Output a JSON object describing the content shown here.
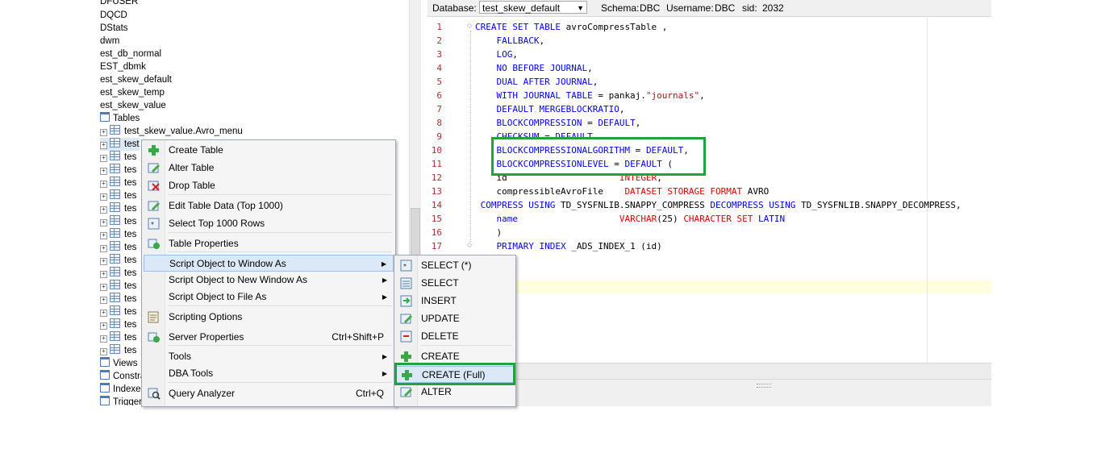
{
  "tree": {
    "items": [
      "DFUSER",
      "DQCD",
      "DStats",
      "dwm",
      "est_db_normal",
      "EST_dbmk",
      "est_skew_default",
      "est_skew_temp",
      "est_skew_value"
    ],
    "tables_folder": "Tables",
    "table_expanded": "test_skew_value.Avro_menu",
    "table_partial": "test",
    "table_rows": [
      "tes",
      "tes",
      "tes",
      "tes",
      "tes",
      "tes",
      "tes",
      "tes",
      "tes",
      "tes",
      "tes",
      "tes",
      "tes",
      "tes",
      "tes",
      "tes"
    ],
    "folders": [
      "Views",
      "Constra",
      "Indexes",
      "Triggers"
    ]
  },
  "toolbar": {
    "database_label": "Database:",
    "database_value": "test_skew_default",
    "schema_label": "Schema:",
    "schema_value": "DBC",
    "username_label": "Username:",
    "username_value": "DBC",
    "sid_label": "sid:",
    "sid_value": "2032"
  },
  "editor": {
    "line_numbers": [
      "1",
      "2",
      "3",
      "4",
      "5",
      "6",
      "7",
      "8",
      "9",
      "10",
      "11",
      "12",
      "13",
      "14",
      "15",
      "16",
      "17"
    ],
    "lines": [
      [
        {
          "t": "CREATE SET TABLE",
          "c": "kw"
        },
        {
          "t": " avroCompressTable ,",
          "c": ""
        }
      ],
      [
        {
          "t": "    FALLBACK",
          "c": "kw"
        },
        {
          "t": ",",
          "c": ""
        }
      ],
      [
        {
          "t": "    LOG",
          "c": "kw"
        },
        {
          "t": ",",
          "c": ""
        }
      ],
      [
        {
          "t": "    NO BEFORE JOURNAL",
          "c": "kw"
        },
        {
          "t": ",",
          "c": ""
        }
      ],
      [
        {
          "t": "    DUAL AFTER JOURNAL",
          "c": "kw"
        },
        {
          "t": ",",
          "c": ""
        }
      ],
      [
        {
          "t": "    WITH JOURNAL TABLE",
          "c": "kw"
        },
        {
          "t": " = pankaj.",
          "c": ""
        },
        {
          "t": "\"journals\"",
          "c": "st"
        },
        {
          "t": ",",
          "c": ""
        }
      ],
      [
        {
          "t": "    DEFAULT MERGEBLOCKRATIO",
          "c": "kw"
        },
        {
          "t": ",",
          "c": ""
        }
      ],
      [
        {
          "t": "    BLOCKCOMPRESSION",
          "c": "kw"
        },
        {
          "t": " = ",
          "c": ""
        },
        {
          "t": "DEFAULT",
          "c": "kw"
        },
        {
          "t": ",",
          "c": ""
        }
      ],
      [
        {
          "t": "    CHECKSUM",
          "c": "kw"
        },
        {
          "t": " = ",
          "c": ""
        },
        {
          "t": "DEFAULT",
          "c": "kw"
        }
      ],
      [
        {
          "t": "    BLOCKCOMPRESSIONALGORITHM",
          "c": "kw"
        },
        {
          "t": " = ",
          "c": ""
        },
        {
          "t": "DEFAULT",
          "c": "kw"
        },
        {
          "t": ",",
          "c": ""
        }
      ],
      [
        {
          "t": "    BLOCKCOMPRESSIONLEVEL",
          "c": "kw"
        },
        {
          "t": " = ",
          "c": ""
        },
        {
          "t": "DEFAULT",
          "c": "kw"
        },
        {
          "t": " (",
          "c": ""
        }
      ],
      [
        {
          "t": "    id",
          "c": ""
        },
        {
          "t": "                     INTEGER",
          "c": "ty"
        },
        {
          "t": ",",
          "c": ""
        }
      ],
      [
        {
          "t": "    compressibleAvroFile    ",
          "c": ""
        },
        {
          "t": "DATASET STORAGE FORMAT",
          "c": "ty"
        },
        {
          "t": " AVRO",
          "c": ""
        }
      ],
      [
        {
          "t": " COMPRESS USING",
          "c": "kw"
        },
        {
          "t": " TD_SYSFNLIB.SNAPPY_COMPRESS ",
          "c": ""
        },
        {
          "t": "DECOMPRESS USING",
          "c": "kw"
        },
        {
          "t": " TD_SYSFNLIB.SNAPPY_DECOMPRESS,",
          "c": ""
        }
      ],
      [
        {
          "t": "    name",
          "c": "kw"
        },
        {
          "t": "                   ",
          "c": ""
        },
        {
          "t": "VARCHAR",
          "c": "ty"
        },
        {
          "t": "(25) ",
          "c": ""
        },
        {
          "t": "CHARACTER SET",
          "c": "ty"
        },
        {
          "t": " LATIN",
          "c": "kw"
        }
      ],
      [
        {
          "t": "    )",
          "c": ""
        }
      ],
      [
        {
          "t": "    PRIMARY INDEX",
          "c": "kw"
        },
        {
          "t": " _ADS_INDEX_1 (id)",
          "c": ""
        }
      ]
    ]
  },
  "context_menu": {
    "items": [
      {
        "label": "Create Table",
        "icon": "create-table-icon"
      },
      {
        "label": "Alter Table",
        "icon": "alter-table-icon"
      },
      {
        "label": "Drop Table",
        "icon": "drop-table-icon"
      },
      {
        "label": "Edit Table Data (Top 1000)",
        "icon": "edit-data-icon"
      },
      {
        "label": "Select Top 1000 Rows",
        "icon": "select-rows-icon"
      },
      {
        "label": "Table Properties",
        "icon": "properties-icon"
      },
      {
        "label": "Script Object to Window As",
        "icon": ""
      },
      {
        "label": "Script Object to New Window As",
        "icon": ""
      },
      {
        "label": "Script Object to File As",
        "icon": ""
      },
      {
        "label": "Scripting Options",
        "icon": "scripting-options-icon"
      },
      {
        "label": "Server Properties",
        "shortcut": "Ctrl+Shift+P",
        "icon": "server-properties-icon"
      },
      {
        "label": "Tools",
        "icon": ""
      },
      {
        "label": "DBA Tools",
        "icon": ""
      },
      {
        "label": "Query Analyzer",
        "shortcut": "Ctrl+Q",
        "icon": "query-analyzer-icon"
      }
    ]
  },
  "submenu": {
    "items": [
      "SELECT (*)",
      "SELECT",
      "INSERT",
      "UPDATE",
      "DELETE",
      "CREATE",
      "CREATE (Full)",
      "ALTER"
    ]
  },
  "colors": {
    "highlight_box": "#21a33b",
    "keyword": "#0000ff",
    "type": "#e00000"
  }
}
